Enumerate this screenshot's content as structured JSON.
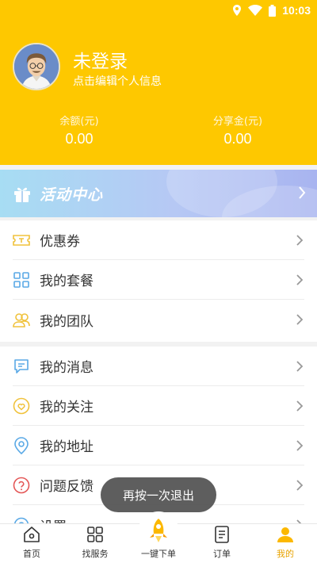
{
  "status_bar": {
    "time": "10:03"
  },
  "profile": {
    "name": "未登录",
    "subtitle": "点击编辑个人信息"
  },
  "stats": [
    {
      "label": "余额(元)",
      "value": "0.00"
    },
    {
      "label": "分享金(元)",
      "value": "0.00"
    }
  ],
  "activity_banner": {
    "title": "活动中心"
  },
  "menu_group_1": [
    {
      "label": "优惠券",
      "icon": "coupon-icon"
    },
    {
      "label": "我的套餐",
      "icon": "grid-icon"
    },
    {
      "label": "我的团队",
      "icon": "team-icon"
    }
  ],
  "menu_group_2": [
    {
      "label": "我的消息",
      "icon": "message-icon"
    },
    {
      "label": "我的关注",
      "icon": "heart-icon"
    },
    {
      "label": "我的地址",
      "icon": "location-icon"
    },
    {
      "label": "问题反馈",
      "icon": "question-icon"
    },
    {
      "label": "设置",
      "icon": "settings-icon"
    }
  ],
  "toast": {
    "text": "再按一次退出"
  },
  "tab_bar": [
    {
      "label": "首页",
      "icon": "home-icon"
    },
    {
      "label": "找服务",
      "icon": "grid-icon"
    },
    {
      "label": "一键下单",
      "icon": "rocket-icon"
    },
    {
      "label": "订单",
      "icon": "order-icon"
    },
    {
      "label": "我的",
      "icon": "user-icon",
      "active": true
    }
  ],
  "colors": {
    "brand_yellow": "#fec800",
    "active_tab": "#e8a300",
    "icon_yellow": "#f0c23c",
    "icon_blue": "#5aa9e6",
    "icon_red": "#e45757"
  }
}
